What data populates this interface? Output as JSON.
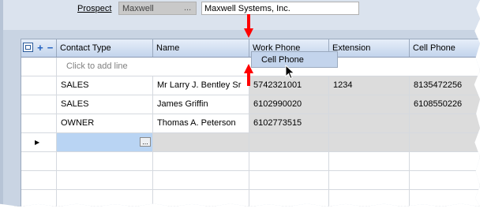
{
  "prospect": {
    "label": "Prospect",
    "code": "Maxwell",
    "code_button": "...",
    "name": "Maxwell Systems, Inc."
  },
  "grid": {
    "columns": [
      "Contact Type",
      "Name",
      "Work Phone",
      "Extension",
      "Cell Phone"
    ],
    "add_row_text": "Click to add line",
    "rows": [
      {
        "contact_type": "SALES",
        "name": "Mr Larry J. Bentley Sr",
        "work_phone": "5742321001",
        "extension": "1234",
        "cell_phone": "8135472256"
      },
      {
        "contact_type": "SALES",
        "name": "James  Griffin",
        "work_phone": "6102990020",
        "extension": "",
        "cell_phone": "6108550226"
      },
      {
        "contact_type": "OWNER",
        "name": "Thomas A. Peterson",
        "work_phone": "6102773515",
        "extension": "",
        "cell_phone": ""
      }
    ],
    "new_row_indicator": "▶",
    "ellipsis_label": "...",
    "dragged_column": "Cell Phone"
  },
  "colors": {
    "annotation_arrow": "#ff0000",
    "header_bg": "#c3d4ec",
    "selected_cell": "#b9d4f3"
  }
}
